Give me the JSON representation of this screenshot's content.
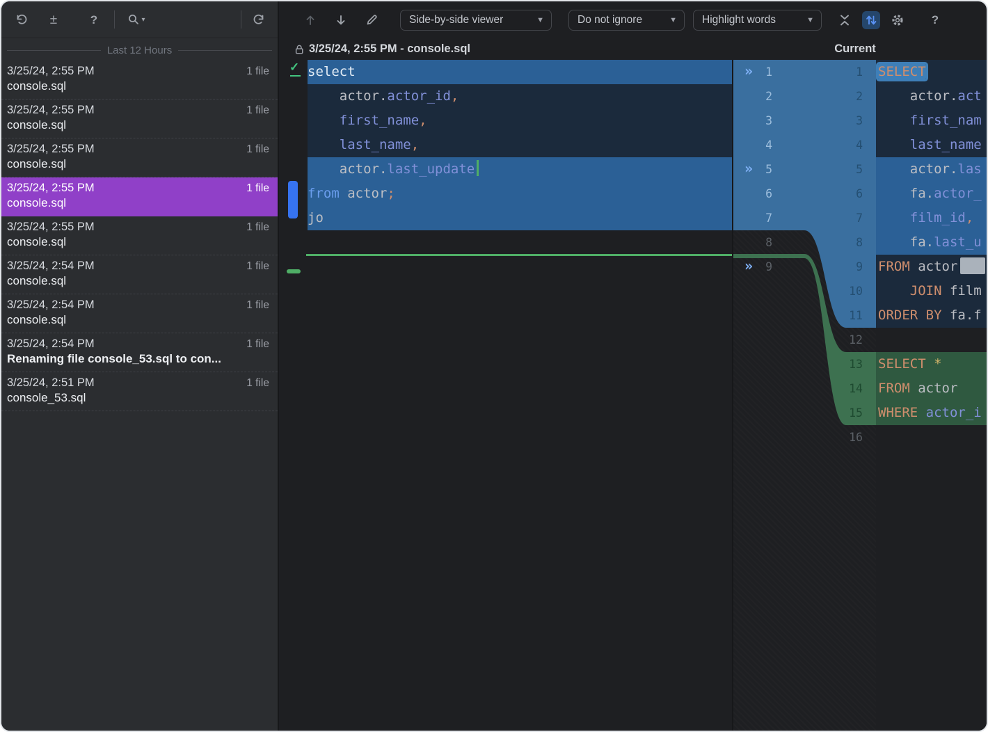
{
  "sidebar": {
    "section_header": "Last 12 Hours",
    "toolbar_icons": [
      "undo-icon",
      "show-diff-icon",
      "help-icon",
      "search-icon",
      "revert-icon"
    ],
    "entries": [
      {
        "time": "3/25/24, 2:55 PM",
        "files": "1 file",
        "name": "console.sql"
      },
      {
        "time": "3/25/24, 2:55 PM",
        "files": "1 file",
        "name": "console.sql"
      },
      {
        "time": "3/25/24, 2:55 PM",
        "files": "1 file",
        "name": "console.sql"
      },
      {
        "time": "3/25/24, 2:55 PM",
        "files": "1 file",
        "name": "console.sql",
        "selected": true
      },
      {
        "time": "3/25/24, 2:55 PM",
        "files": "1 file",
        "name": "console.sql"
      },
      {
        "time": "3/25/24, 2:54 PM",
        "files": "1 file",
        "name": "console.sql"
      },
      {
        "time": "3/25/24, 2:54 PM",
        "files": "1 file",
        "name": "console.sql"
      },
      {
        "time": "3/25/24, 2:54 PM",
        "files": "1 file",
        "name": "Renaming file console_53.sql to con...",
        "emphasis": true
      },
      {
        "time": "3/25/24, 2:51 PM",
        "files": "1 file",
        "name": "console_53.sql"
      }
    ]
  },
  "main": {
    "toolbar": {
      "icons": [
        "up-icon",
        "down-icon",
        "edit-icon",
        "collapse-icon",
        "sync-scrolling-icon",
        "settings-icon",
        "help-icon"
      ],
      "dropdowns": [
        {
          "label": "Side-by-side viewer"
        },
        {
          "label": "Do not ignore"
        },
        {
          "label": "Highlight words"
        }
      ],
      "help_label": "?"
    },
    "header": {
      "left_title": "3/25/24, 2:55 PM - console.sql",
      "right_title": "Current"
    }
  },
  "diff": {
    "left_lines": [
      {
        "bg": "bright",
        "seg": [
          [
            "select",
            "selw"
          ]
        ]
      },
      {
        "bg": "tint",
        "seg": [
          [
            "    actor.",
            ""
          ],
          [
            "actor_id",
            "col"
          ],
          [
            ",",
            "orange"
          ]
        ]
      },
      {
        "bg": "tint",
        "seg": [
          [
            "    ",
            ""
          ],
          [
            "first_name",
            "col"
          ],
          [
            ",",
            "orange"
          ]
        ]
      },
      {
        "bg": "tint",
        "seg": [
          [
            "    ",
            ""
          ],
          [
            "last_name",
            "col"
          ],
          [
            ",",
            "orange"
          ]
        ]
      },
      {
        "bg": "bright",
        "seg": [
          [
            "    actor.",
            ""
          ],
          [
            "last_update",
            "col"
          ]
        ],
        "caret": "green"
      },
      {
        "bg": "bright",
        "seg": [
          [
            "from",
            "kwblue"
          ],
          [
            " actor",
            ""
          ],
          [
            ";",
            "orange"
          ]
        ]
      },
      {
        "bg": "bright",
        "seg": [
          [
            "jo",
            ""
          ]
        ]
      },
      {
        "bg": "none",
        "seg": []
      },
      {
        "bg": "none",
        "seg": []
      }
    ],
    "right_lines": [
      {
        "bg": "tint",
        "seg": [
          [
            "SELECT",
            "kw wordbox"
          ]
        ]
      },
      {
        "bg": "tint",
        "seg": [
          [
            "    actor.",
            ""
          ],
          [
            "act",
            "col"
          ]
        ]
      },
      {
        "bg": "tint",
        "seg": [
          [
            "    ",
            ""
          ],
          [
            "first_nam",
            "col"
          ]
        ]
      },
      {
        "bg": "tint",
        "seg": [
          [
            "    ",
            ""
          ],
          [
            "last_name",
            "col"
          ]
        ]
      },
      {
        "bg": "bright",
        "seg": [
          [
            "    actor.",
            ""
          ],
          [
            "las",
            "col"
          ]
        ]
      },
      {
        "bg": "bright",
        "seg": [
          [
            "    fa.",
            ""
          ],
          [
            "actor_",
            "col"
          ]
        ]
      },
      {
        "bg": "bright",
        "seg": [
          [
            "    ",
            ""
          ],
          [
            "film_id",
            "col"
          ],
          [
            ",",
            "orange"
          ]
        ]
      },
      {
        "bg": "bright",
        "seg": [
          [
            "    fa.",
            ""
          ],
          [
            "last_u",
            "col"
          ]
        ]
      },
      {
        "bg": "tint",
        "seg": [
          [
            "FROM",
            "kw"
          ],
          [
            " actor",
            ""
          ]
        ],
        "caret": "block"
      },
      {
        "bg": "tint",
        "seg": [
          [
            "    ",
            ""
          ],
          [
            "JOIN",
            "kw"
          ],
          [
            " film",
            ""
          ]
        ]
      },
      {
        "bg": "tint",
        "seg": [
          [
            "ORDER BY",
            "kw"
          ],
          [
            " fa.f",
            ""
          ]
        ]
      },
      {
        "bg": "none",
        "seg": []
      },
      {
        "bg": "green",
        "seg": [
          [
            "SELECT",
            "kw"
          ],
          [
            " ",
            ""
          ],
          [
            "*",
            "star"
          ]
        ]
      },
      {
        "bg": "green",
        "seg": [
          [
            "FROM",
            "kw"
          ],
          [
            " actor",
            ""
          ]
        ]
      },
      {
        "bg": "green",
        "seg": [
          [
            "WHERE",
            "kw"
          ],
          [
            " ",
            ""
          ],
          [
            "actor_i",
            "col"
          ]
        ]
      },
      {
        "bg": "none",
        "seg": []
      }
    ],
    "gutter_left": [
      {
        "n": 1,
        "state": "blue",
        "chevron": true
      },
      {
        "n": 2,
        "state": "blue"
      },
      {
        "n": 3,
        "state": "blue"
      },
      {
        "n": 4,
        "state": "blue"
      },
      {
        "n": 5,
        "state": "blue",
        "chevron": true
      },
      {
        "n": 6,
        "state": "blue"
      },
      {
        "n": 7,
        "state": "blue"
      },
      {
        "n": 8,
        "state": "plain"
      },
      {
        "n": 9,
        "state": "plain",
        "chevron": true
      }
    ],
    "gutter_right": [
      {
        "n": 1,
        "state": "blue"
      },
      {
        "n": 2,
        "state": "blue"
      },
      {
        "n": 3,
        "state": "blue"
      },
      {
        "n": 4,
        "state": "blue"
      },
      {
        "n": 5,
        "state": "blue"
      },
      {
        "n": 6,
        "state": "blue"
      },
      {
        "n": 7,
        "state": "blue"
      },
      {
        "n": 8,
        "state": "blue"
      },
      {
        "n": 9,
        "state": "blue"
      },
      {
        "n": 10,
        "state": "blue"
      },
      {
        "n": 11,
        "state": "blue"
      },
      {
        "n": 12,
        "state": "plain"
      },
      {
        "n": 13,
        "state": "green"
      },
      {
        "n": 14,
        "state": "green"
      },
      {
        "n": 15,
        "state": "green"
      },
      {
        "n": 16,
        "state": "plain"
      }
    ]
  },
  "colors": {
    "selection_purple": "#9040c8",
    "diff_changed_blue_row": "#2b6096",
    "diff_changed_blue_shape": "#3a6f9f",
    "diff_inserted_green_row": "#2f5940",
    "diff_inserted_green_shape": "#3d7150",
    "insertion_marker_green": "#4fae66",
    "gutter_change_bar_blue": "#3673f0",
    "keyword_orange": "#cf8e6d",
    "column_periwinkle": "#8190d8"
  }
}
